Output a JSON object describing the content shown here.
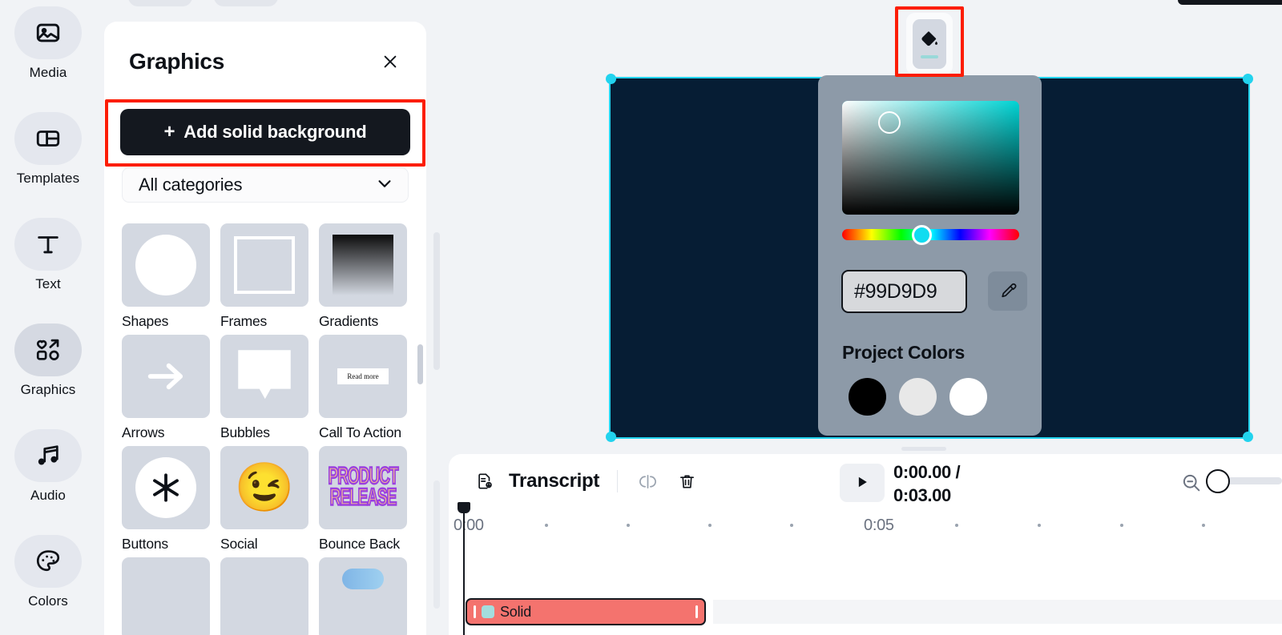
{
  "app": {
    "accent_cyan": "#22d3ee",
    "canvas_bg": "#061d34",
    "clip_color": "#f4736e"
  },
  "rail": {
    "items": [
      {
        "label": "Media",
        "icon": "image-icon",
        "active": false
      },
      {
        "label": "Templates",
        "icon": "layout-icon",
        "active": false
      },
      {
        "label": "Text",
        "icon": "text-t-icon",
        "active": false
      },
      {
        "label": "Graphics",
        "icon": "graphics-shapes-icon",
        "active": true
      },
      {
        "label": "Audio",
        "icon": "music-note-icon",
        "active": false
      },
      {
        "label": "Colors",
        "icon": "palette-icon",
        "active": false
      }
    ]
  },
  "panel": {
    "title": "Graphics",
    "close_icon": "close-icon",
    "add_button_label": "Add solid background",
    "add_button_plus": "+",
    "category_value": "All categories",
    "chevron_icon": "chevron-down-icon",
    "tiles": [
      {
        "label": "Shapes",
        "art": "circle"
      },
      {
        "label": "Frames",
        "art": "frame"
      },
      {
        "label": "Gradients",
        "art": "gradient"
      },
      {
        "label": "Arrows",
        "art": "arrow"
      },
      {
        "label": "Bubbles",
        "art": "bubble"
      },
      {
        "label": "Call To Action",
        "art": "readmore",
        "art_text": "Read more"
      },
      {
        "label": "Buttons",
        "art": "asterisk"
      },
      {
        "label": "Social",
        "art": "emoji",
        "art_text": "😉"
      },
      {
        "label": "Bounce Back",
        "art": "product-release",
        "art_text_1": "PRODUCT",
        "art_text_2": "RELEASE"
      }
    ]
  },
  "toolbar": {
    "fill_icon": "paint-bucket-icon",
    "fill_swatch_color": "#99d9d9"
  },
  "picker": {
    "hex_value": "#99D9D9",
    "eyedropper_icon": "eyedropper-icon",
    "project_colors_label": "Project Colors",
    "swatches": [
      "#000000",
      "#e8e8e8",
      "#ffffff"
    ]
  },
  "timeline": {
    "title": "Transcript",
    "transcript_icon": "transcript-document-icon",
    "split_icon": "split-clip-icon",
    "delete_icon": "trash-icon",
    "play_icon": "play-icon",
    "current_time": "0:00.00 /",
    "total_time": "0:03.00",
    "zoom_out_icon": "zoom-out-icon",
    "ruler_labels": [
      "0:00",
      "0:05"
    ],
    "clip": {
      "label": "Solid",
      "swatch_color": "#a4dede"
    }
  }
}
